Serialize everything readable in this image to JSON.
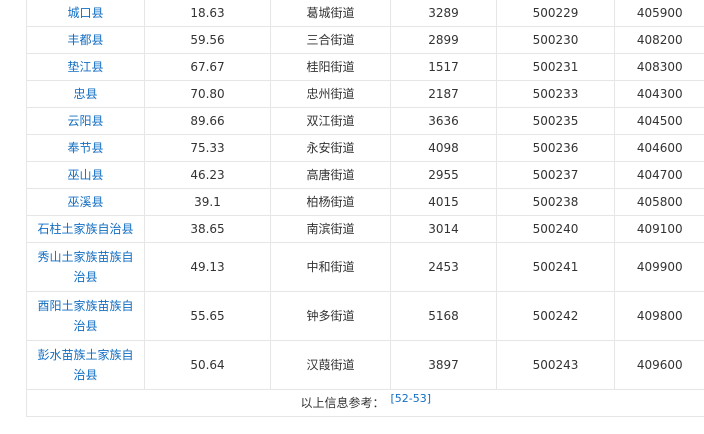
{
  "table": {
    "rows": [
      {
        "county": "城口县",
        "area": "18.63",
        "seat": "葛城街道",
        "population": "3289",
        "code": "500229",
        "postal": "405900"
      },
      {
        "county": "丰都县",
        "area": "59.56",
        "seat": "三合街道",
        "population": "2899",
        "code": "500230",
        "postal": "408200"
      },
      {
        "county": "垫江县",
        "area": "67.67",
        "seat": "桂阳街道",
        "population": "1517",
        "code": "500231",
        "postal": "408300"
      },
      {
        "county": "忠县",
        "area": "70.80",
        "seat": "忠州街道",
        "population": "2187",
        "code": "500233",
        "postal": "404300"
      },
      {
        "county": "云阳县",
        "area": "89.66",
        "seat": "双江街道",
        "population": "3636",
        "code": "500235",
        "postal": "404500"
      },
      {
        "county": "奉节县",
        "area": "75.33",
        "seat": "永安街道",
        "population": "4098",
        "code": "500236",
        "postal": "404600"
      },
      {
        "county": "巫山县",
        "area": "46.23",
        "seat": "高唐街道",
        "population": "2955",
        "code": "500237",
        "postal": "404700"
      },
      {
        "county": "巫溪县",
        "area": "39.1",
        "seat": "柏杨街道",
        "population": "4015",
        "code": "500238",
        "postal": "405800"
      },
      {
        "county": "石柱土家族自治县",
        "area": "38.65",
        "seat": "南滨街道",
        "population": "3014",
        "code": "500240",
        "postal": "409100"
      },
      {
        "county": "秀山土家族苗族自治县",
        "area": "49.13",
        "seat": "中和街道",
        "population": "2453",
        "code": "500241",
        "postal": "409900"
      },
      {
        "county": "酉阳土家族苗族自治县",
        "area": "55.65",
        "seat": "钟多街道",
        "population": "5168",
        "code": "500242",
        "postal": "409800"
      },
      {
        "county": "彭水苗族土家族自治县",
        "area": "50.64",
        "seat": "汉葭街道",
        "population": "3897",
        "code": "500243",
        "postal": "409600"
      }
    ]
  },
  "footer": {
    "text": "以上信息参考：",
    "ref": "[52-53]"
  },
  "colors": {
    "link": "#136ec2",
    "border": "#e6e6e6",
    "text": "#333333"
  }
}
